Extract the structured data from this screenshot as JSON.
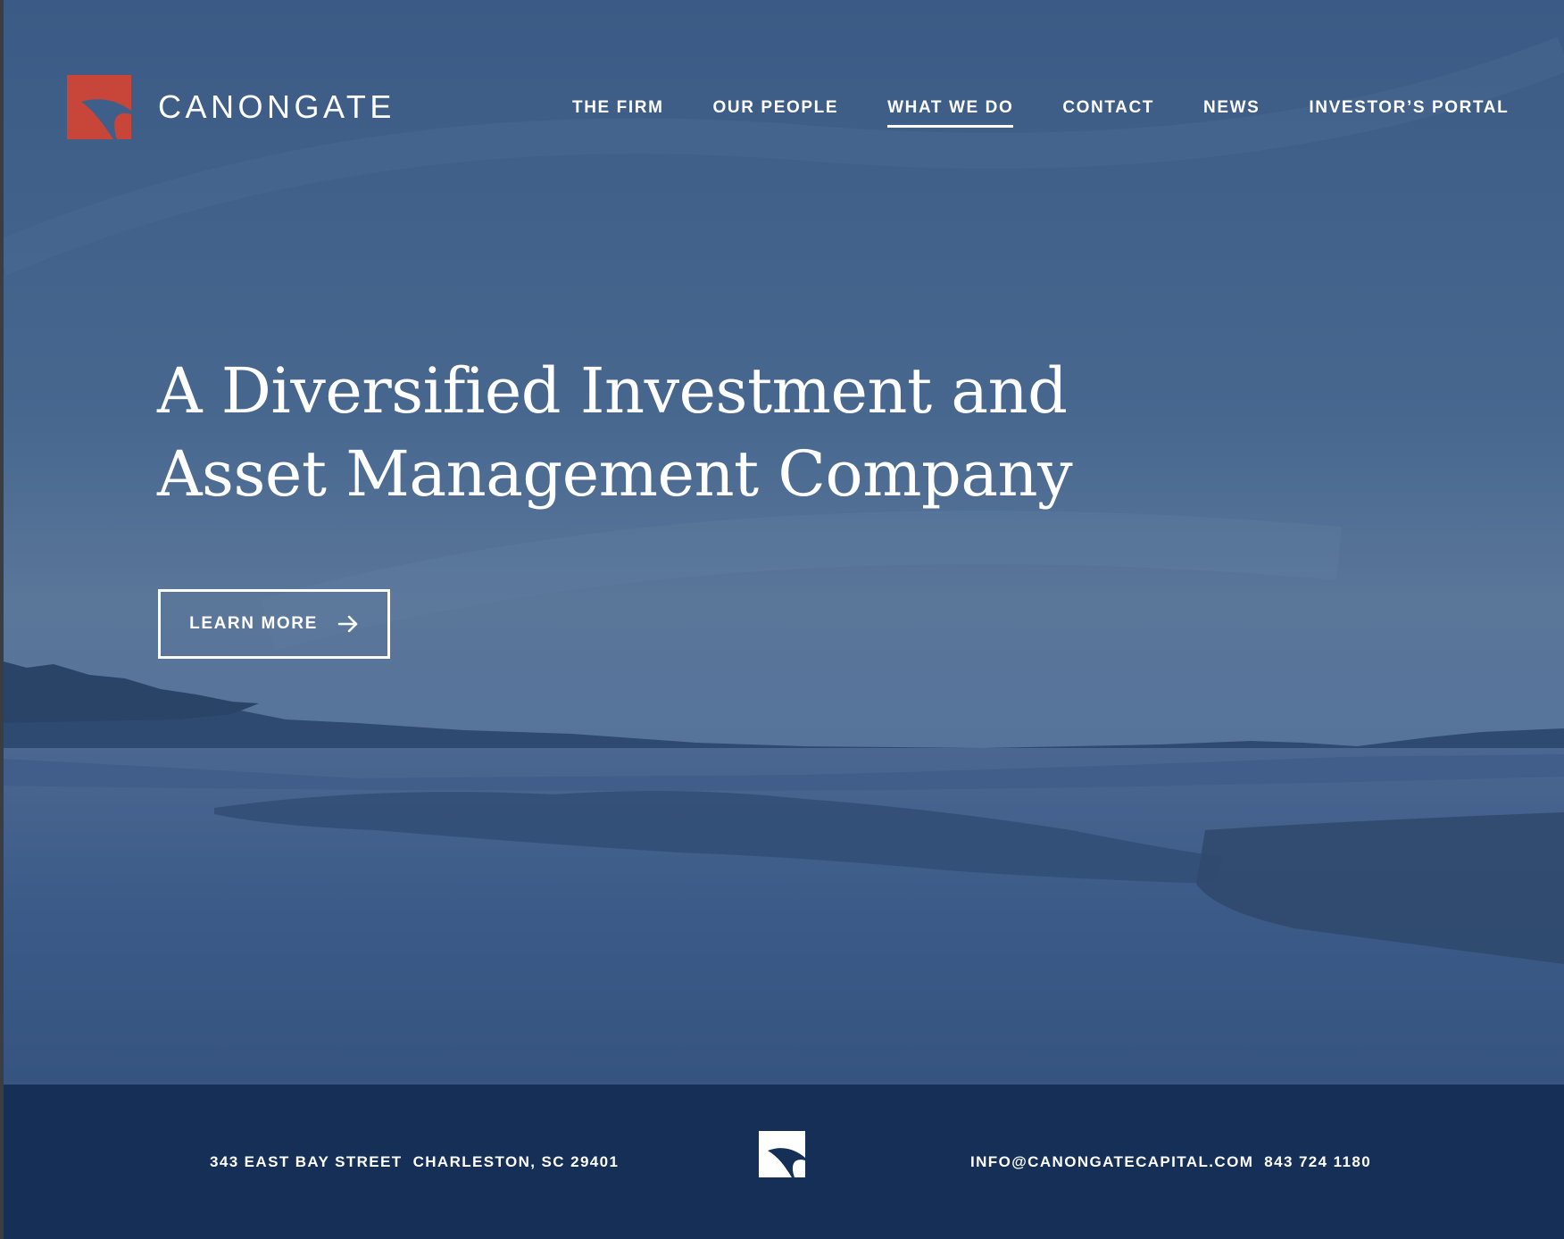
{
  "header": {
    "brand": "CANONGATE",
    "logo_color": "#c8453a",
    "nav": [
      {
        "label": "THE FIRM",
        "active": false
      },
      {
        "label": "OUR PEOPLE",
        "active": false
      },
      {
        "label": "WHAT WE DO",
        "active": true
      },
      {
        "label": "CONTACT",
        "active": false
      },
      {
        "label": "NEWS",
        "active": false
      },
      {
        "label": "INVESTOR’S PORTAL",
        "active": false
      }
    ]
  },
  "hero": {
    "headline_line1": "A Diversified Investment and",
    "headline_line2": "Asset Management Company",
    "cta_label": "LEARN MORE",
    "cta_icon": "arrow-right-icon",
    "overlay_color": "#3e5f8a"
  },
  "footer": {
    "street": "343 EAST BAY STREET",
    "city": "CHARLESTON, SC 29401",
    "email": "INFO@CANONGATECAPITAL.COM",
    "phone": "843 724 1180",
    "background_color": "#152f57"
  }
}
